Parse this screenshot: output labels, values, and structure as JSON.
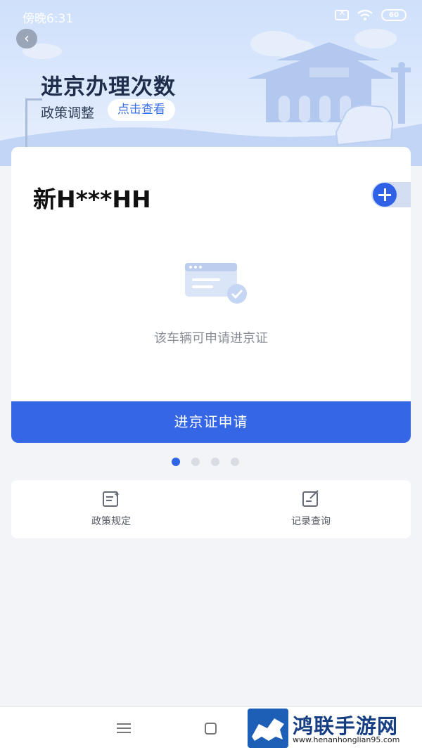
{
  "status_bar": {
    "time": "傍晚6:31",
    "battery": "60",
    "icons": [
      "sim-off-icon",
      "wifi-icon",
      "battery-icon"
    ]
  },
  "header": {
    "back_icon": "chevron-left-icon",
    "title": "进京办理次数",
    "policy_note": "政策调整",
    "view_link": "点击查看"
  },
  "vehicle_card": {
    "plate": "新H***HH",
    "add_icon": "plus-circle-icon",
    "empty_icon": "document-check-icon",
    "status_text": "该车辆可申请进京证",
    "apply_button": "进京证申请"
  },
  "pager": {
    "count": 4,
    "active_index": 0
  },
  "quick_actions": [
    {
      "label": "政策规定",
      "icon": "policy-document-icon"
    },
    {
      "label": "记录查询",
      "icon": "record-edit-icon"
    }
  ],
  "nav_bar": {
    "icons": [
      "menu-icon",
      "home-square-icon"
    ]
  },
  "watermark": {
    "title": "鸿联手游网",
    "url": "www.henanhonglian95.com"
  },
  "colors": {
    "primary": "#3566e6",
    "banner": "#cfe0fb",
    "background": "#f2f4f8"
  }
}
